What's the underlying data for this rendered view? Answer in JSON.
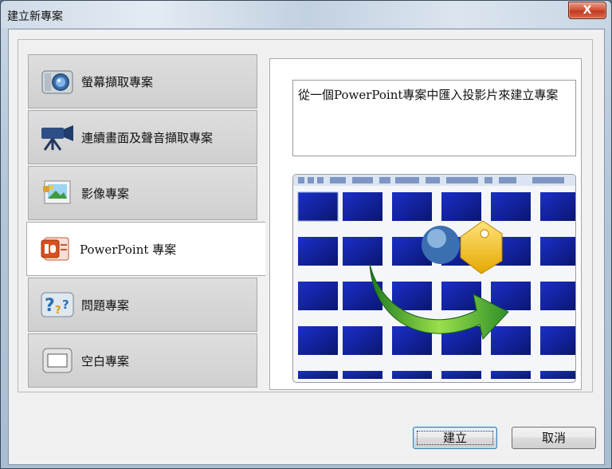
{
  "window": {
    "title": "建立新專案",
    "close_label": "X"
  },
  "tabs": [
    {
      "label": "螢幕擷取專案",
      "icon": "camera-icon",
      "active": false
    },
    {
      "label": "連續畫面及聲音擷取專案",
      "icon": "video-camera-icon",
      "active": false
    },
    {
      "label": "影像專案",
      "icon": "image-icon",
      "active": false
    },
    {
      "label": "PowerPoint 專案",
      "icon": "powerpoint-icon",
      "active": true
    },
    {
      "label": "問題專案",
      "icon": "question-icon",
      "active": false
    },
    {
      "label": "空白專案",
      "icon": "blank-page-icon",
      "active": false
    }
  ],
  "panel": {
    "description": "從一個PowerPoint專案中匯入投影片來建立專案",
    "preview_icon": "import-slides-icon"
  },
  "buttons": {
    "create_label": "建立",
    "cancel_label": "取消"
  }
}
